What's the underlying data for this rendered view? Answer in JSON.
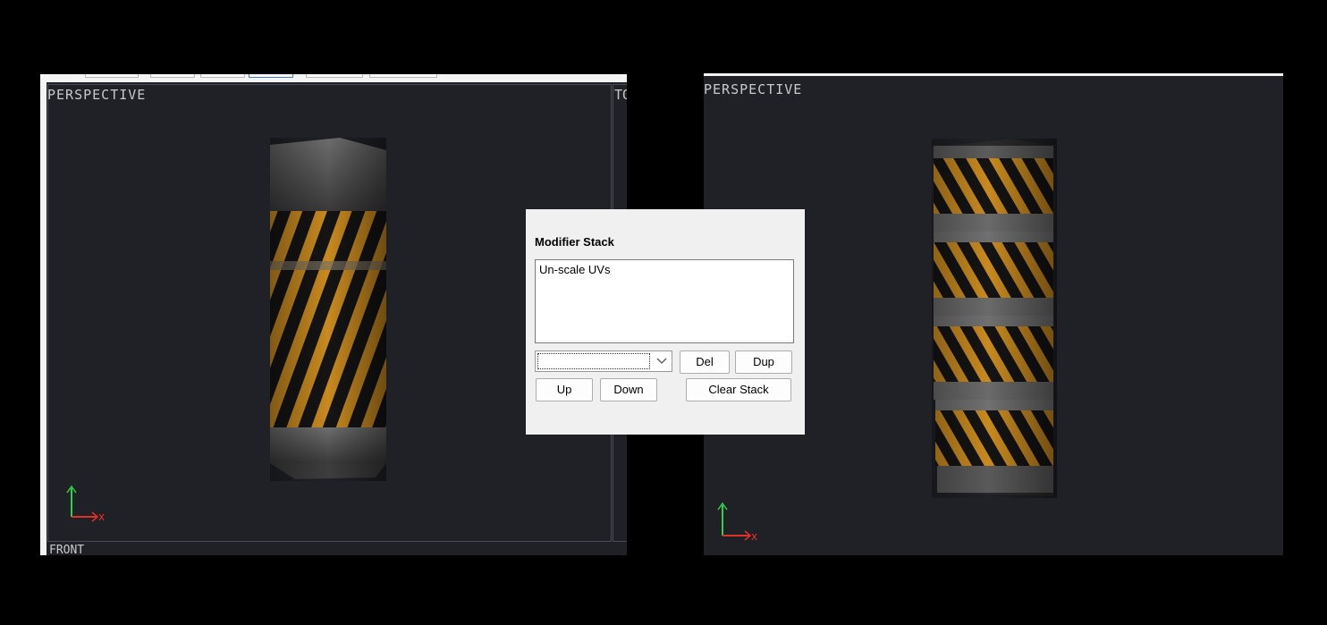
{
  "left_viewport": {
    "label": "PERSPECTIVE",
    "bottom_label": "FRONT",
    "side_label": "TO"
  },
  "right_viewport": {
    "label": "PERSPECTIVE"
  },
  "axis_labels": {
    "x": "x",
    "y": "y"
  },
  "modifier_panel": {
    "title": "Modifier Stack",
    "stack_items": [
      "Un-scale UVs"
    ],
    "combo_value": "",
    "buttons": {
      "del": "Del",
      "dup": "Dup",
      "up": "Up",
      "down": "Down",
      "clear": "Clear Stack"
    }
  },
  "colors": {
    "viewport_bg": "#202127",
    "axis_x": "#e0302a",
    "axis_y": "#2bd14a",
    "stripe_orange": "#c98a1e"
  }
}
